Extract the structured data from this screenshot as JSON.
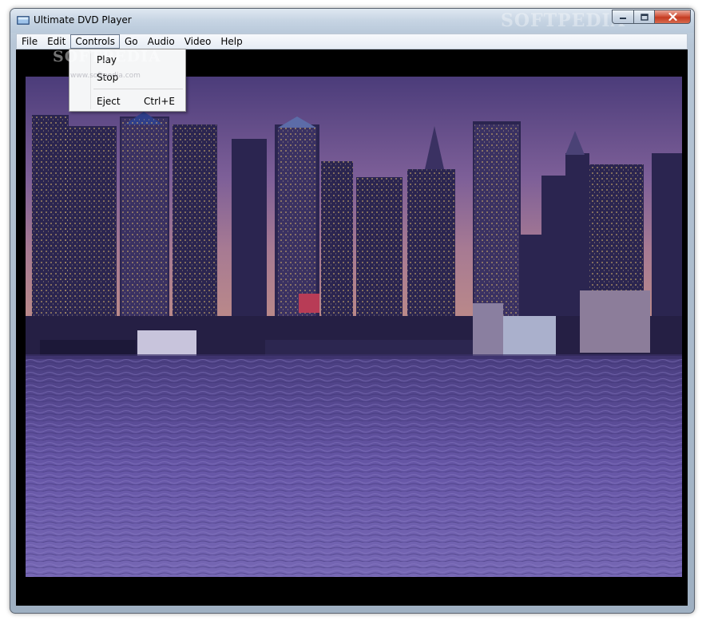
{
  "window": {
    "title": "Ultimate DVD Player",
    "watermark": "SOFTPEDIA"
  },
  "menubar": {
    "items": [
      {
        "label": "File"
      },
      {
        "label": "Edit"
      },
      {
        "label": "Controls",
        "active": true
      },
      {
        "label": "Go"
      },
      {
        "label": "Audio"
      },
      {
        "label": "Video"
      },
      {
        "label": "Help"
      }
    ]
  },
  "controls_menu": {
    "play": "Play",
    "stop": "Stop",
    "eject": "Eject",
    "eject_shortcut": "Ctrl+E"
  },
  "overlay": {
    "watermark": "SOFTPEDIA",
    "watermark_url": "www.softpedia.com"
  },
  "icons": {
    "app": "dvd-player-icon",
    "minimize": "minimize-icon",
    "maximize": "maximize-icon",
    "close": "close-icon"
  },
  "colors": {
    "close_button": "#c43b22",
    "sky": "#8a6fa8",
    "water": "#5c4f9a"
  }
}
